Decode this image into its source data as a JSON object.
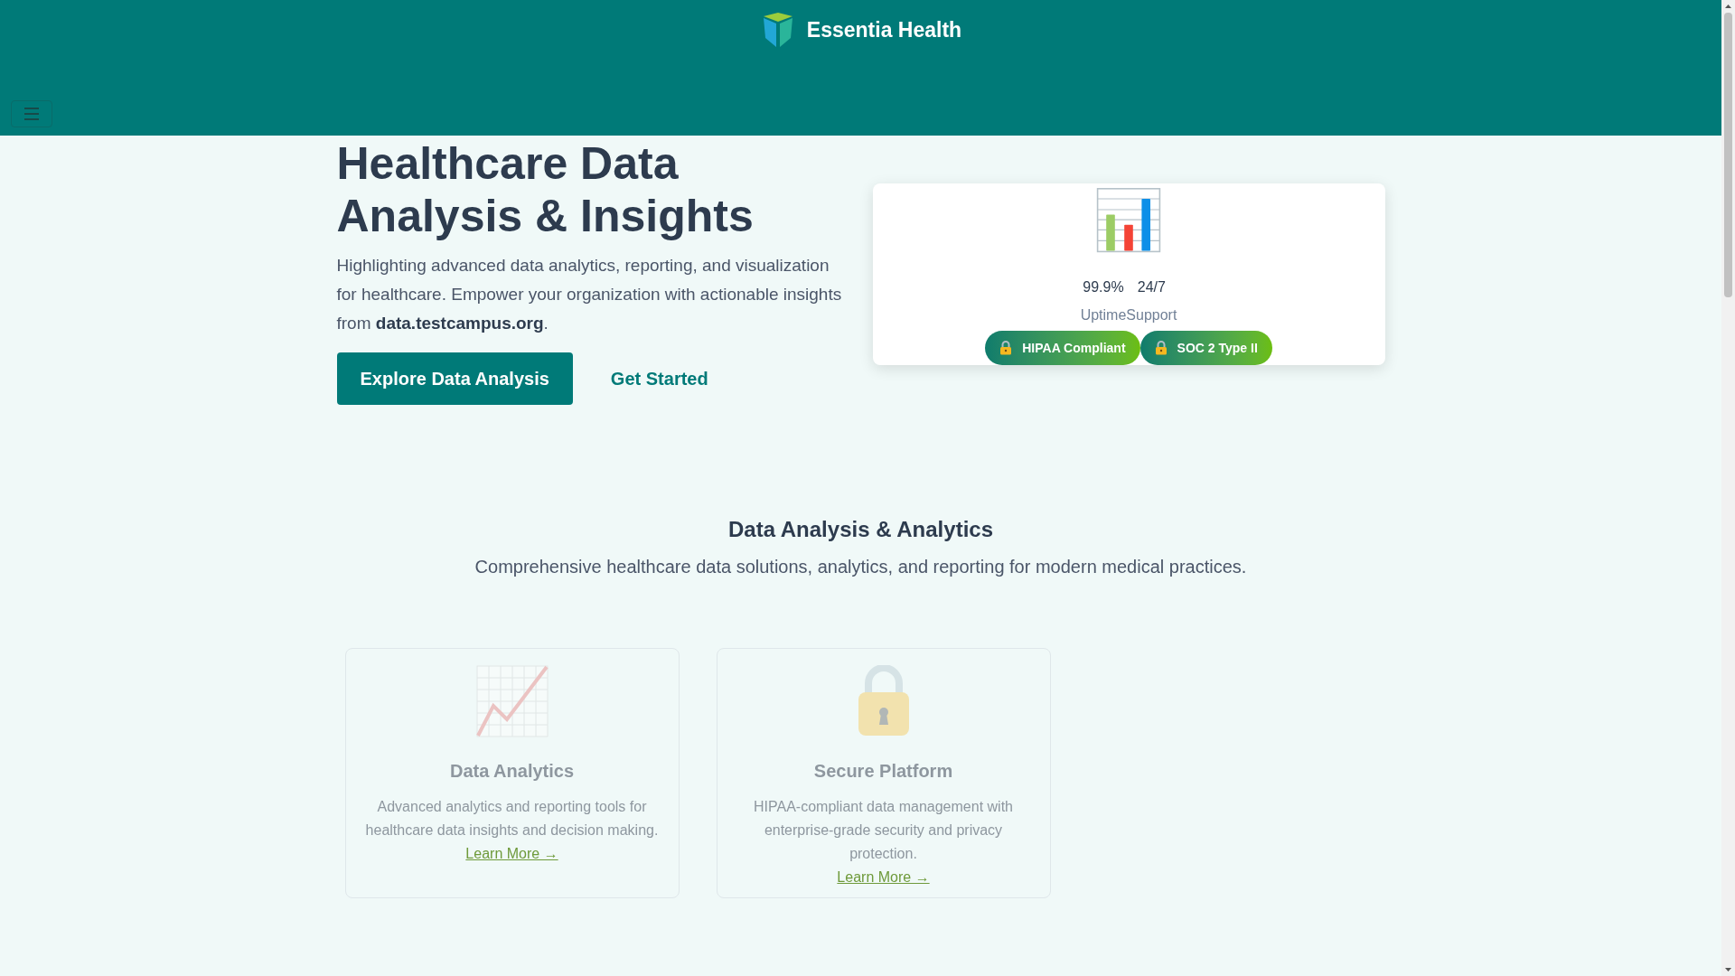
{
  "header": {
    "brand": "Essentia Health"
  },
  "hero": {
    "title": "Healthcare Data Analysis & Insights",
    "text": "Highlighting advanced data analytics, reporting, and visualization for healthcare. Empower your organization with actionable insights from **data.testcampus.org**.",
    "buttons": [
      {
        "label": "Explore Data Analysis",
        "kind": "primary"
      },
      {
        "label": "Get Started",
        "kind": "link"
      }
    ],
    "stats": [
      {
        "value": "99.9%",
        "label": "Uptime"
      },
      {
        "value": "24/7",
        "label": "Support"
      }
    ],
    "badges": [
      {
        "label": "HIPAA Compliant"
      },
      {
        "label": "SOC 2 Type II"
      }
    ]
  },
  "section": {
    "title": "Data Analysis & Analytics",
    "subtitle": "Comprehensive healthcare data solutions, analytics, and reporting for modern medical practices.",
    "features": [
      {
        "kind": "chart",
        "title": "Data Analytics",
        "description": "Advanced analytics and reporting tools for healthcare data insights and decision making.",
        "link": "Learn More →"
      },
      {
        "kind": "lock",
        "title": "Secure Platform",
        "description": "HIPAA-compliant data management with enterprise-grade security and privacy protection.",
        "link": "Learn More →"
      }
    ]
  }
}
